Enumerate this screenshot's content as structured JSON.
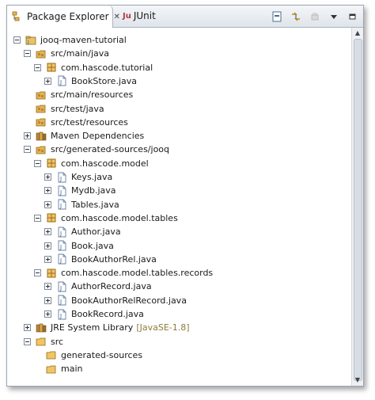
{
  "tabs": [
    {
      "label": "Package Explorer",
      "close": "✕",
      "icon": "package-explorer-icon"
    },
    {
      "label": "JUnit",
      "icon_text": "Ju",
      "icon": "junit-icon"
    }
  ],
  "toolbar": [
    "collapse-all-icon",
    "link-with-editor-icon",
    "view-menu-icon",
    "minimize-icon"
  ],
  "tree": [
    {
      "label": "jooq-maven-tutorial",
      "level": 0,
      "toggle": "expanded",
      "icon": "project-icon"
    },
    {
      "label": "src/main/java",
      "level": 1,
      "toggle": "expanded",
      "icon": "source-folder-icon"
    },
    {
      "label": "com.hascode.tutorial",
      "level": 2,
      "toggle": "expanded",
      "icon": "package-icon"
    },
    {
      "label": "BookStore.java",
      "level": 3,
      "toggle": "collapsed",
      "icon": "java-file-icon"
    },
    {
      "label": "src/main/resources",
      "level": 1,
      "toggle": "none",
      "icon": "source-folder-icon"
    },
    {
      "label": "src/test/java",
      "level": 1,
      "toggle": "none",
      "icon": "source-folder-icon"
    },
    {
      "label": "src/test/resources",
      "level": 1,
      "toggle": "none",
      "icon": "source-folder-icon"
    },
    {
      "label": "Maven Dependencies",
      "level": 1,
      "toggle": "collapsed",
      "icon": "library-icon"
    },
    {
      "label": "src/generated-sources/jooq",
      "level": 1,
      "toggle": "expanded",
      "icon": "source-folder-icon"
    },
    {
      "label": "com.hascode.model",
      "level": 2,
      "toggle": "expanded",
      "icon": "package-icon"
    },
    {
      "label": "Keys.java",
      "level": 3,
      "toggle": "collapsed",
      "icon": "java-file-icon"
    },
    {
      "label": "Mydb.java",
      "level": 3,
      "toggle": "collapsed",
      "icon": "java-file-icon"
    },
    {
      "label": "Tables.java",
      "level": 3,
      "toggle": "collapsed",
      "icon": "java-file-icon"
    },
    {
      "label": "com.hascode.model.tables",
      "level": 2,
      "toggle": "expanded",
      "icon": "package-icon"
    },
    {
      "label": "Author.java",
      "level": 3,
      "toggle": "collapsed",
      "icon": "java-file-icon"
    },
    {
      "label": "Book.java",
      "level": 3,
      "toggle": "collapsed",
      "icon": "java-file-icon"
    },
    {
      "label": "BookAuthorRel.java",
      "level": 3,
      "toggle": "collapsed",
      "icon": "java-file-icon"
    },
    {
      "label": "com.hascode.model.tables.records",
      "level": 2,
      "toggle": "expanded",
      "icon": "package-icon"
    },
    {
      "label": "AuthorRecord.java",
      "level": 3,
      "toggle": "collapsed",
      "icon": "java-file-icon"
    },
    {
      "label": "BookAuthorRelRecord.java",
      "level": 3,
      "toggle": "collapsed",
      "icon": "java-file-icon"
    },
    {
      "label": "BookRecord.java",
      "level": 3,
      "toggle": "collapsed",
      "icon": "java-file-icon"
    },
    {
      "label": "JRE System Library",
      "suffix": "[JavaSE-1.8]",
      "level": 1,
      "toggle": "collapsed",
      "icon": "library-icon"
    },
    {
      "label": "src",
      "level": 1,
      "toggle": "expanded",
      "icon": "folder-icon"
    },
    {
      "label": "generated-sources",
      "level": 2,
      "toggle": "none",
      "icon": "folder-icon"
    },
    {
      "label": "main",
      "level": 2,
      "toggle": "none",
      "icon": "folder-icon"
    }
  ]
}
